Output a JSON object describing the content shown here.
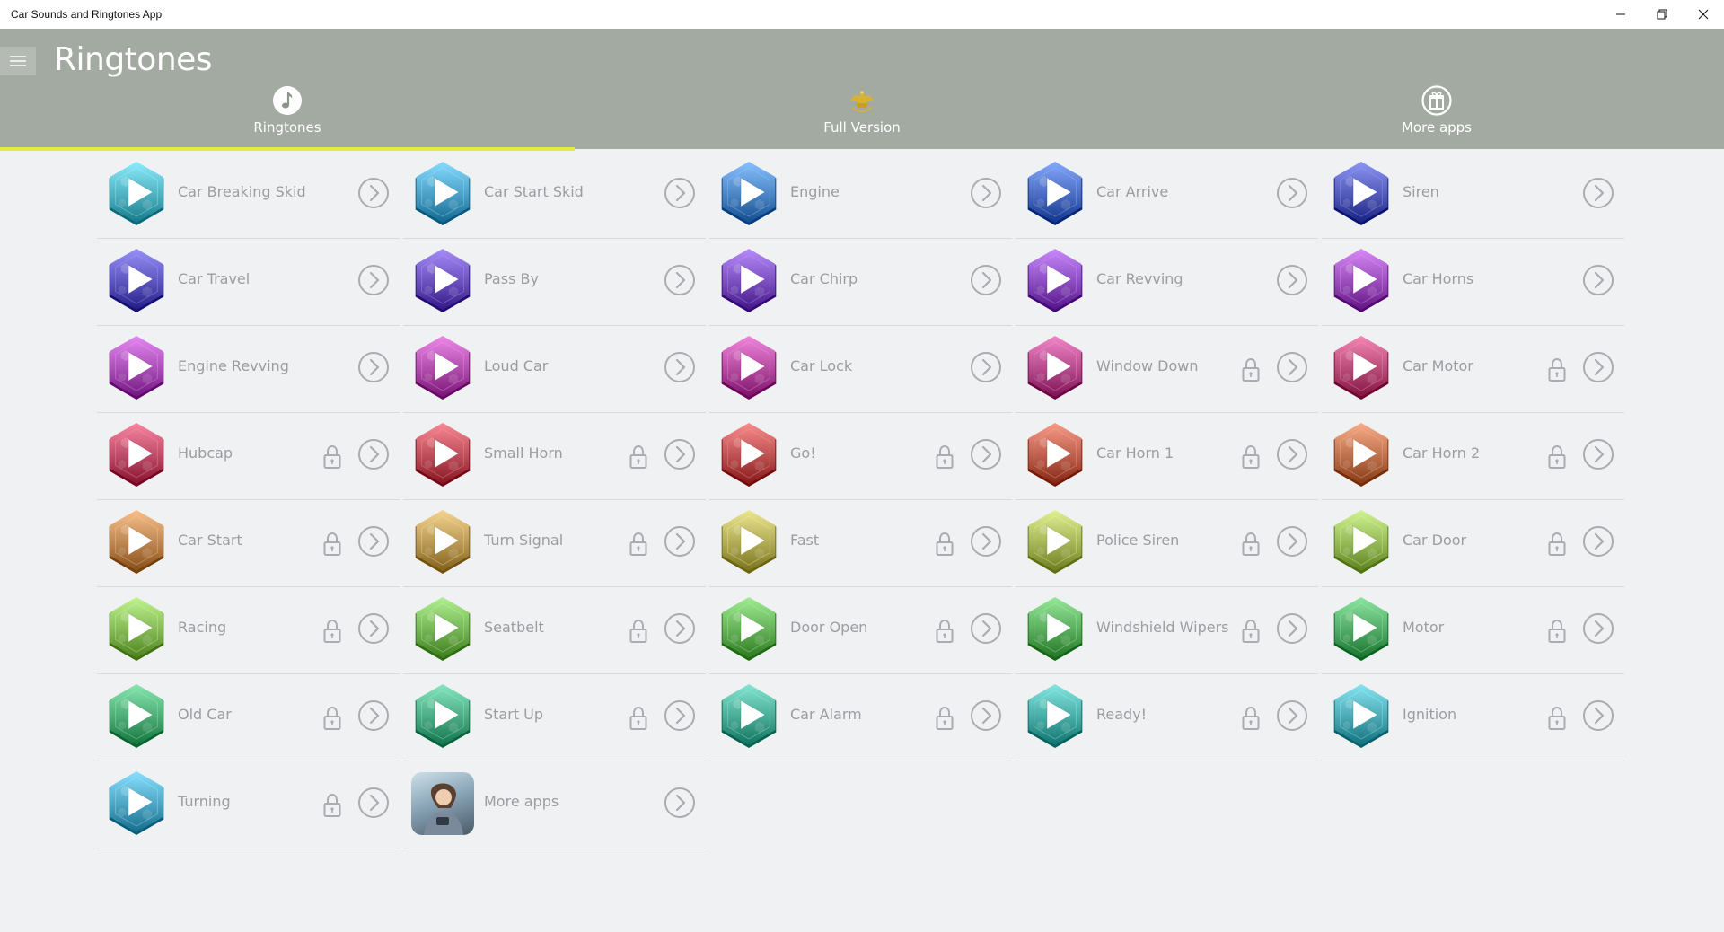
{
  "window": {
    "title": "Car Sounds and Ringtones App"
  },
  "header": {
    "title": "Ringtones"
  },
  "tabs": [
    {
      "label": "Ringtones",
      "icon": "music-note-icon",
      "active": true
    },
    {
      "label": "Full Version",
      "icon": "crown-icon",
      "active": false
    },
    {
      "label": "More apps",
      "icon": "gift-icon",
      "active": false
    }
  ],
  "colors": {
    "header": "#a3aaa2",
    "tab_indicator": "#e6ec3c",
    "background": "#f0f1f2",
    "text": "#9a9ea2"
  },
  "items": [
    {
      "name": "Car Breaking Skid",
      "locked": false,
      "color": "#4fb0c0"
    },
    {
      "name": "Car Start Skid",
      "locked": false,
      "color": "#4a9fc6"
    },
    {
      "name": "Engine",
      "locked": false,
      "color": "#4a84c4"
    },
    {
      "name": "Car Arrive",
      "locked": false,
      "color": "#4a6cc0"
    },
    {
      "name": "Siren",
      "locked": false,
      "color": "#5058b8"
    },
    {
      "name": "Car Travel",
      "locked": false,
      "color": "#5a54bc"
    },
    {
      "name": "Pass By",
      "locked": false,
      "color": "#6a50bc"
    },
    {
      "name": "Car Chirp",
      "locked": false,
      "color": "#7a4ebe"
    },
    {
      "name": "Car Revving",
      "locked": false,
      "color": "#8a4cbe"
    },
    {
      "name": "Car Horns",
      "locked": false,
      "color": "#9a4cba"
    },
    {
      "name": "Engine Revving",
      "locked": false,
      "color": "#a84cb6"
    },
    {
      "name": "Loud Car",
      "locked": false,
      "color": "#b04cac"
    },
    {
      "name": "Car Lock",
      "locked": false,
      "color": "#b44aa0"
    },
    {
      "name": "Window Down",
      "locked": true,
      "color": "#b44a8c"
    },
    {
      "name": "Car Motor",
      "locked": true,
      "color": "#b84a78"
    },
    {
      "name": "Hubcap",
      "locked": true,
      "color": "#bc4a66"
    },
    {
      "name": "Small Horn",
      "locked": true,
      "color": "#bc4c58"
    },
    {
      "name": "Go!",
      "locked": true,
      "color": "#bc5050"
    },
    {
      "name": "Car Horn 1",
      "locked": true,
      "color": "#bc5e4c"
    },
    {
      "name": "Car Horn 2",
      "locked": true,
      "color": "#bc704c"
    },
    {
      "name": "Car Start",
      "locked": true,
      "color": "#bc844e"
    },
    {
      "name": "Turn Signal",
      "locked": true,
      "color": "#b89852"
    },
    {
      "name": "Fast",
      "locked": true,
      "color": "#b0aa54"
    },
    {
      "name": "Police Siren",
      "locked": true,
      "color": "#a4b456"
    },
    {
      "name": "Car Door",
      "locked": true,
      "color": "#94b856"
    },
    {
      "name": "Racing",
      "locked": true,
      "color": "#84b854"
    },
    {
      "name": "Seatbelt",
      "locked": true,
      "color": "#74b454"
    },
    {
      "name": "Door Open",
      "locked": true,
      "color": "#64b056"
    },
    {
      "name": "Windshield Wipers",
      "locked": true,
      "color": "#58ac5c"
    },
    {
      "name": "Motor",
      "locked": true,
      "color": "#50aa66"
    },
    {
      "name": "Old Car",
      "locked": true,
      "color": "#4caa74"
    },
    {
      "name": "Start Up",
      "locked": true,
      "color": "#4aaa84"
    },
    {
      "name": "Car Alarm",
      "locked": true,
      "color": "#48aa94"
    },
    {
      "name": "Ready!",
      "locked": true,
      "color": "#48aaa4"
    },
    {
      "name": "Ignition",
      "locked": true,
      "color": "#4aa8b4"
    },
    {
      "name": "Turning",
      "locked": true,
      "color": "#4ca4c2"
    },
    {
      "name": "More apps",
      "locked": false,
      "type": "more-apps",
      "icon": "person-photo-icon"
    }
  ]
}
